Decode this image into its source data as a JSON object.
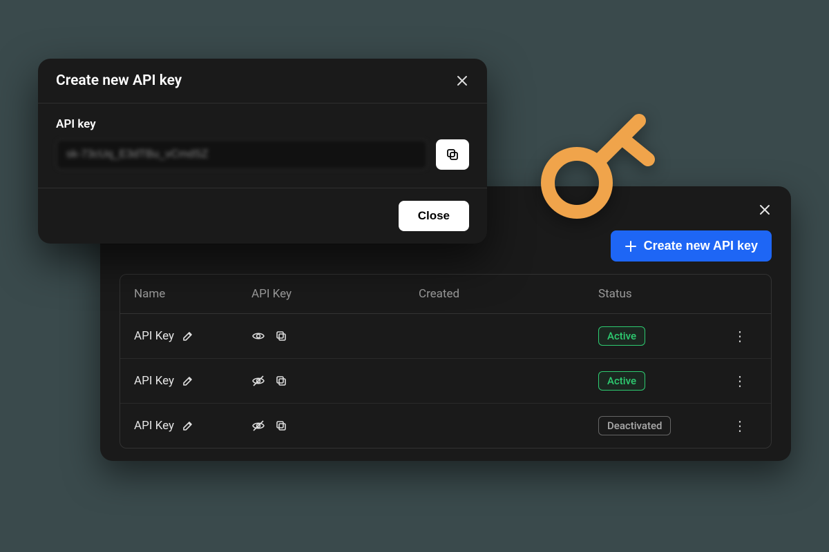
{
  "modal": {
    "title": "Create new API key",
    "field_label": "API key",
    "key_value": "sk-73cUq_E3dTBu_vCmdSZ",
    "close_label": "Close"
  },
  "list_panel": {
    "create_button_label": "Create new API key",
    "columns": {
      "name": "Name",
      "api_key": "API Key",
      "created": "Created",
      "status": "Status"
    },
    "rows": [
      {
        "name": "API Key",
        "visible": true,
        "created": "",
        "status": "Active",
        "status_class": "active"
      },
      {
        "name": "API Key",
        "visible": false,
        "created": "",
        "status": "Active",
        "status_class": "active"
      },
      {
        "name": "API Key",
        "visible": false,
        "created": "",
        "status": "Deactivated",
        "status_class": "deactivated"
      }
    ]
  },
  "colors": {
    "primary": "#1e66f5",
    "active": "#2ecc71",
    "key_illustration": "#f0a44b"
  }
}
